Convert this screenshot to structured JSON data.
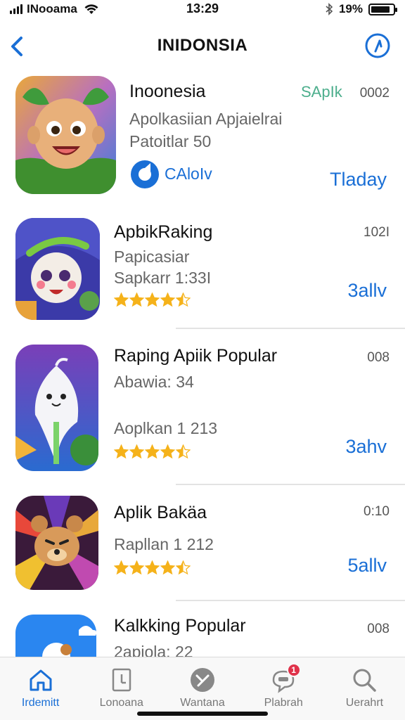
{
  "status_bar": {
    "carrier": "INooama",
    "time": "13:29",
    "battery_percent": "19%",
    "battery_level": 0.85
  },
  "nav": {
    "title": "INIDONSIA",
    "back_icon": "chevron-left-icon",
    "action_icon": "compass-icon"
  },
  "featured": {
    "name": "Inoonesia",
    "badge_text": "SApIk",
    "count": "0002",
    "subtitle": "Apolkasiian Apjaielrai",
    "meta": "Patoitlar 50",
    "developer_label": "CAloIv",
    "get_label": "Tladay"
  },
  "apps": [
    {
      "name": "ApbikRaking",
      "count": "102I",
      "line1": "Papicasiar",
      "line2": "Sapkarr 1:33I",
      "rating": 4.5,
      "get_label": "3allv"
    },
    {
      "name": "Raping Apiik Popular",
      "count": "008",
      "line1": "Abawia: 34",
      "line2": "Aoplkan 1 213",
      "rating": 4.5,
      "get_label": "3ahv"
    },
    {
      "name": "Aplik Bakäa",
      "count": "0:10",
      "line1": "Rapllan 1 212",
      "line2": "",
      "rating": 4.5,
      "get_label": "5allv"
    },
    {
      "name": "Kalkking Popular",
      "count": "008",
      "line1": "2apiola: 22",
      "line2": "",
      "rating": 0,
      "get_label": ""
    }
  ],
  "tabs": [
    {
      "label": "Irdemitt",
      "icon": "home-icon",
      "active": true
    },
    {
      "label": "Lonoana",
      "icon": "apps-icon",
      "active": false
    },
    {
      "label": "Wantana",
      "icon": "games-icon",
      "active": false
    },
    {
      "label": "Plabrah",
      "icon": "updates-icon",
      "active": false,
      "badge": "1"
    },
    {
      "label": "Uerahrt",
      "icon": "search-icon",
      "active": false
    }
  ],
  "colors": {
    "accent": "#1a6fd6",
    "star": "#f5b21a",
    "badge": "#e0324a"
  }
}
